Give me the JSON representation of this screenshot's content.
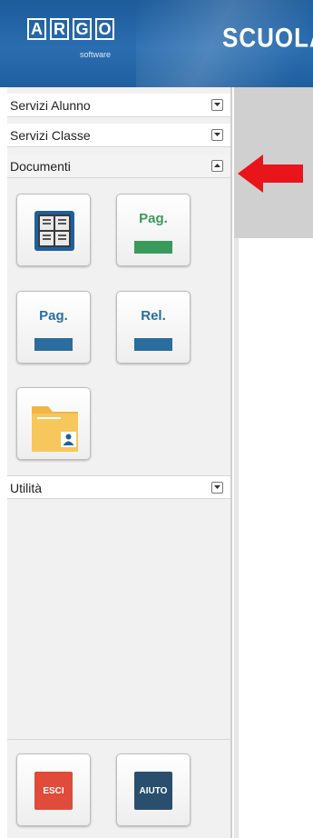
{
  "header": {
    "logo_letters": [
      "A",
      "R",
      "G",
      "O"
    ],
    "logo_subtitle": "software",
    "app_title": "SCUOLAN"
  },
  "sidebar": {
    "panels": [
      {
        "label": "Servizi Alunno",
        "state": "collapsed"
      },
      {
        "label": "Servizi Classe",
        "state": "collapsed"
      },
      {
        "label": "Documenti",
        "state": "expanded"
      },
      {
        "label": "Utilità",
        "state": "collapsed"
      }
    ],
    "documenti_tiles": [
      {
        "icon": "notice-board-icon",
        "label": ""
      },
      {
        "icon": "page-green-icon",
        "label": "Pag."
      },
      {
        "icon": "page-blue-icon",
        "label": "Pag."
      },
      {
        "icon": "report-icon",
        "label": "Rel."
      },
      {
        "icon": "folder-user-icon",
        "label": ""
      }
    ],
    "footer_buttons": [
      {
        "label": "ESCI",
        "color": "#e04b3a"
      },
      {
        "label": "AIUTO",
        "color": "#2a4f6e"
      }
    ]
  },
  "annotation": {
    "icon": "red-arrow-icon",
    "color": "#e8151b"
  }
}
